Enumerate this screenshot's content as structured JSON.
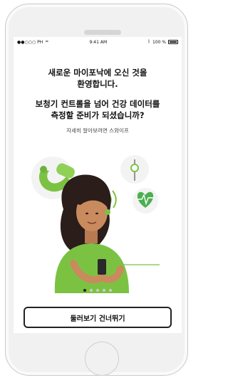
{
  "statusbar": {
    "carrier": "●●○○○ PH",
    "time": "9:41 AM",
    "battery": "100 %"
  },
  "welcome": {
    "line1": "새로운 마이포낙에 오신 것을",
    "line2": "환영합니다."
  },
  "question": {
    "line1": "보청기 컨트롤을 넘어 건강 데이터를",
    "line2": "측정할 준비가 되셨습니까?"
  },
  "hint": "자세히 알아보려면 스와이프",
  "pager": {
    "total": 5,
    "active": 1
  },
  "skip_button": "둘러보기 건너뛰기",
  "colors": {
    "accent_green": "#7cc242",
    "hair": "#2a1d1a",
    "skin": "#c98a5e"
  },
  "icons": {
    "hearing_aid": "hearing-aid-icon",
    "volume": "volume-slider-icon",
    "heart": "heart-rate-icon",
    "phone": "smartphone-icon"
  }
}
